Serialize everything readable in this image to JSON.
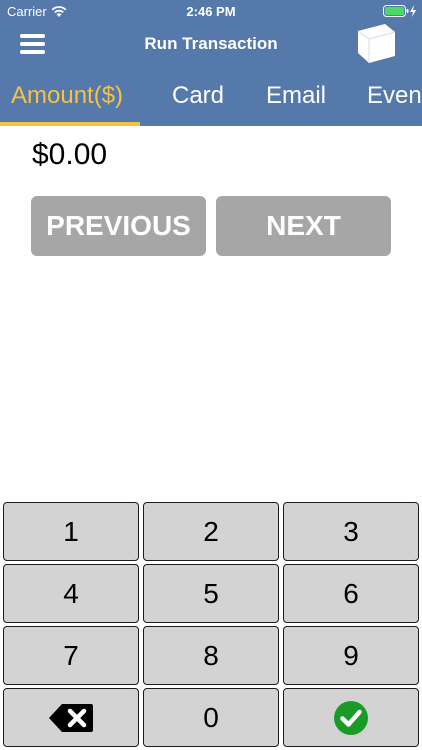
{
  "status_bar": {
    "carrier": "Carrier",
    "time": "2:46 PM"
  },
  "navbar": {
    "title": "Run Transaction",
    "menu_icon": "hamburger-menu-icon",
    "device_icon": "card-reader-icon"
  },
  "tabs": [
    {
      "label": "Amount($)",
      "active": true
    },
    {
      "label": "Card",
      "active": false
    },
    {
      "label": "Email",
      "active": false
    },
    {
      "label": "Event",
      "active": false
    }
  ],
  "amount": {
    "value": "$0.00"
  },
  "buttons": {
    "previous": "PREVIOUS",
    "next": "NEXT"
  },
  "keypad": {
    "keys": [
      "1",
      "2",
      "3",
      "4",
      "5",
      "6",
      "7",
      "8",
      "9"
    ],
    "zero": "0",
    "backspace_icon": "backspace-icon",
    "confirm_icon": "checkmark-icon"
  },
  "colors": {
    "header": "#5479aa",
    "accent": "#f5c242",
    "button": "#a6a6a6",
    "key": "#d3d3d3",
    "confirm": "#1a9b28",
    "battery": "#4cd964"
  }
}
